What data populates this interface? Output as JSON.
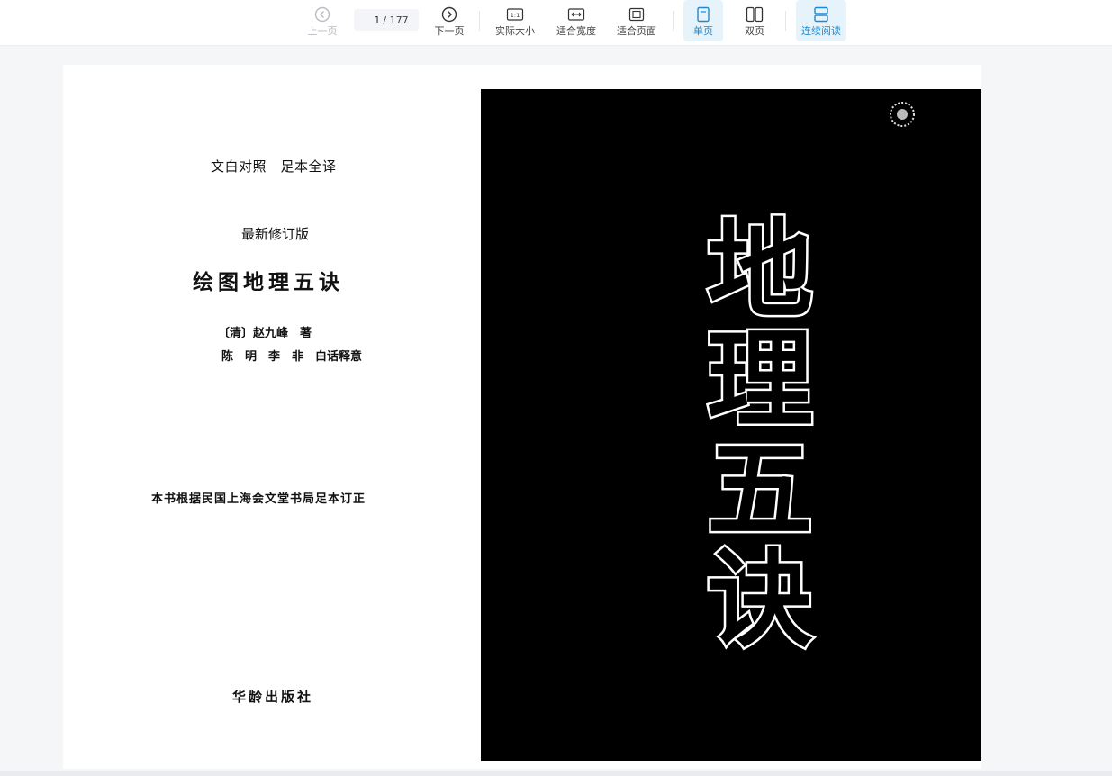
{
  "toolbar": {
    "prev_label": "上一页",
    "next_label": "下一页",
    "page_current": "1",
    "page_total": "/ 177",
    "actual_size_label": "实际大小",
    "fit_width_label": "适合宽度",
    "fit_page_label": "适合页面",
    "single_page_label": "单页",
    "double_page_label": "双页",
    "continuous_label": "连续阅读",
    "actual_size_icon_text": "1:1"
  },
  "document": {
    "left_page": {
      "line1": "文白对照　足本全译",
      "line2": "最新修订版",
      "title": "绘图地理五诀",
      "author": "〔清〕赵九峰　著",
      "translators": "陈　明　李　非　白话释意",
      "source_note": "本书根据民国上海会文堂书局足本订正",
      "publisher": "华龄出版社"
    },
    "cover": {
      "chars": [
        "地",
        "理",
        "五",
        "诀"
      ]
    }
  },
  "colors": {
    "accent": "#1e88d2",
    "active_bg": "#e6f3fb",
    "disabled": "#b8bcc4"
  }
}
